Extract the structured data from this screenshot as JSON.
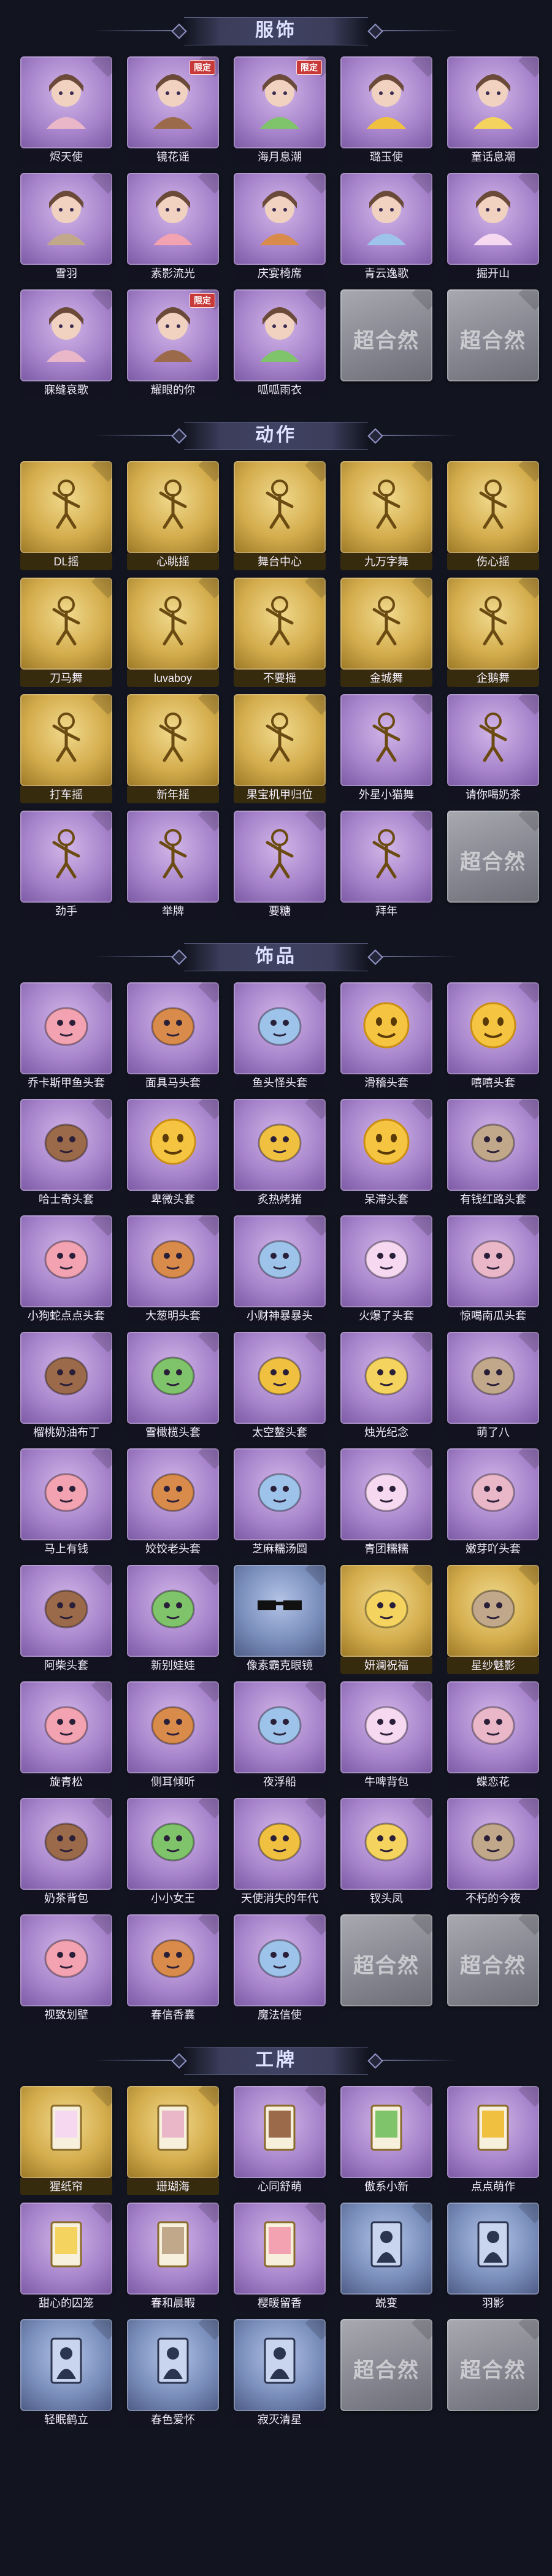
{
  "sections": [
    {
      "title": "服饰",
      "items": [
        {
          "label": "烬天使",
          "frame": "purple",
          "icon": "character-portrait-icon",
          "tag": ""
        },
        {
          "label": "镜花谣",
          "frame": "purple",
          "icon": "character-portrait-icon",
          "tag": "限定"
        },
        {
          "label": "海月息潮",
          "frame": "purple",
          "icon": "character-portrait-icon",
          "tag": "限定"
        },
        {
          "label": "璐玉使",
          "frame": "purple",
          "icon": "character-portrait-icon",
          "tag": ""
        },
        {
          "label": "童话息潮",
          "frame": "purple",
          "icon": "character-portrait-icon",
          "tag": ""
        },
        {
          "label": "雪羽",
          "frame": "purple",
          "icon": "character-portrait-icon",
          "tag": ""
        },
        {
          "label": "素影流光",
          "frame": "purple",
          "icon": "character-portrait-icon",
          "tag": ""
        },
        {
          "label": "庆宴椅席",
          "frame": "purple",
          "icon": "character-portrait-icon",
          "tag": ""
        },
        {
          "label": "青云逸歌",
          "frame": "purple",
          "icon": "character-portrait-icon",
          "tag": ""
        },
        {
          "label": "掘开山",
          "frame": "purple",
          "icon": "character-portrait-icon",
          "tag": ""
        },
        {
          "label": "寐缝哀歌",
          "frame": "purple",
          "icon": "character-portrait-icon",
          "tag": ""
        },
        {
          "label": "耀眼的你",
          "frame": "purple",
          "icon": "character-portrait-icon",
          "tag": "限定"
        },
        {
          "label": "呱呱雨衣",
          "frame": "purple",
          "icon": "character-portrait-icon",
          "tag": ""
        },
        {
          "label": "",
          "frame": "gray",
          "icon": "placeholder-icon",
          "tag": "",
          "placeholder": "超合然"
        },
        {
          "label": "",
          "frame": "gray",
          "icon": "placeholder-icon",
          "tag": "",
          "placeholder": "超合然"
        }
      ]
    },
    {
      "title": "动作",
      "items": [
        {
          "label": "DL摇",
          "frame": "gold",
          "icon": "pose-figure-icon",
          "tag": ""
        },
        {
          "label": "心眺摇",
          "frame": "gold",
          "icon": "pose-figure-icon",
          "tag": ""
        },
        {
          "label": "舞台中心",
          "frame": "gold",
          "icon": "pose-figure-icon",
          "tag": ""
        },
        {
          "label": "九万字舞",
          "frame": "gold",
          "icon": "pose-figure-icon",
          "tag": ""
        },
        {
          "label": "伤心摇",
          "frame": "gold",
          "icon": "pose-figure-icon",
          "tag": ""
        },
        {
          "label": "刀马舞",
          "frame": "gold",
          "icon": "pose-figure-icon",
          "tag": ""
        },
        {
          "label": "luvaboy",
          "frame": "gold",
          "icon": "pose-figure-icon",
          "tag": ""
        },
        {
          "label": "不要摇",
          "frame": "gold",
          "icon": "pose-figure-icon",
          "tag": ""
        },
        {
          "label": "金城舞",
          "frame": "gold",
          "icon": "pose-figure-icon",
          "tag": ""
        },
        {
          "label": "企鹅舞",
          "frame": "gold",
          "icon": "pose-figure-icon",
          "tag": ""
        },
        {
          "label": "打车摇",
          "frame": "gold",
          "icon": "pose-figure-icon",
          "tag": ""
        },
        {
          "label": "新年摇",
          "frame": "gold",
          "icon": "pose-figure-icon",
          "tag": ""
        },
        {
          "label": "果宝机甲归位",
          "frame": "gold",
          "icon": "pose-figure-icon",
          "tag": ""
        },
        {
          "label": "外星小猫舞",
          "frame": "purple",
          "icon": "pose-figure-icon",
          "tag": ""
        },
        {
          "label": "请你喝奶茶",
          "frame": "purple",
          "icon": "pose-figure-icon",
          "tag": ""
        },
        {
          "label": "劲手",
          "frame": "purple",
          "icon": "pose-figure-icon",
          "tag": ""
        },
        {
          "label": "举牌",
          "frame": "purple",
          "icon": "pose-figure-icon",
          "tag": ""
        },
        {
          "label": "要糖",
          "frame": "purple",
          "icon": "pose-figure-icon",
          "tag": ""
        },
        {
          "label": "拜年",
          "frame": "purple",
          "icon": "pose-figure-icon",
          "tag": ""
        },
        {
          "label": "",
          "frame": "gray",
          "icon": "placeholder-icon",
          "tag": "",
          "placeholder": "超合然"
        }
      ]
    },
    {
      "title": "饰品",
      "items": [
        {
          "label": "乔卡斯甲鱼头套",
          "frame": "purple",
          "icon": "accessory-icon",
          "tag": ""
        },
        {
          "label": "面具马头套",
          "frame": "purple",
          "icon": "accessory-icon",
          "tag": ""
        },
        {
          "label": "鱼头怪头套",
          "frame": "purple",
          "icon": "accessory-icon",
          "tag": ""
        },
        {
          "label": "滑稽头套",
          "frame": "purple",
          "icon": "emoji-face-icon",
          "tag": ""
        },
        {
          "label": "嘻嘻头套",
          "frame": "purple",
          "icon": "emoji-face-icon",
          "tag": ""
        },
        {
          "label": "哈士奇头套",
          "frame": "purple",
          "icon": "accessory-icon",
          "tag": ""
        },
        {
          "label": "卑微头套",
          "frame": "purple",
          "icon": "emoji-face-icon",
          "tag": ""
        },
        {
          "label": "炙热烤猪",
          "frame": "purple",
          "icon": "accessory-icon",
          "tag": ""
        },
        {
          "label": "呆滞头套",
          "frame": "purple",
          "icon": "emoji-face-icon",
          "tag": ""
        },
        {
          "label": "有钱红路头套",
          "frame": "purple",
          "icon": "accessory-icon",
          "tag": ""
        },
        {
          "label": "小狗蛇点点头套",
          "frame": "purple",
          "icon": "accessory-icon",
          "tag": ""
        },
        {
          "label": "大葱明头套",
          "frame": "purple",
          "icon": "accessory-icon",
          "tag": ""
        },
        {
          "label": "小财神暴暴头",
          "frame": "purple",
          "icon": "accessory-icon",
          "tag": ""
        },
        {
          "label": "火爆了头套",
          "frame": "purple",
          "icon": "accessory-icon",
          "tag": ""
        },
        {
          "label": "惊喝南瓜头套",
          "frame": "purple",
          "icon": "accessory-icon",
          "tag": ""
        },
        {
          "label": "榴桃奶油布丁",
          "frame": "purple",
          "icon": "accessory-icon",
          "tag": ""
        },
        {
          "label": "雪橄榄头套",
          "frame": "purple",
          "icon": "accessory-icon",
          "tag": ""
        },
        {
          "label": "太空鳌头套",
          "frame": "purple",
          "icon": "accessory-icon",
          "tag": ""
        },
        {
          "label": "烛光纪念",
          "frame": "purple",
          "icon": "accessory-icon",
          "tag": ""
        },
        {
          "label": "萌了八",
          "frame": "purple",
          "icon": "accessory-icon",
          "tag": ""
        },
        {
          "label": "马上有钱",
          "frame": "purple",
          "icon": "accessory-icon",
          "tag": ""
        },
        {
          "label": "姣饺老头套",
          "frame": "purple",
          "icon": "accessory-icon",
          "tag": ""
        },
        {
          "label": "芝麻糯汤圆",
          "frame": "purple",
          "icon": "accessory-icon",
          "tag": ""
        },
        {
          "label": "青团糯糯",
          "frame": "purple",
          "icon": "accessory-icon",
          "tag": ""
        },
        {
          "label": "嫩芽吖头套",
          "frame": "purple",
          "icon": "accessory-icon",
          "tag": ""
        },
        {
          "label": "阿柴头套",
          "frame": "purple",
          "icon": "accessory-icon",
          "tag": ""
        },
        {
          "label": "新别娃娃",
          "frame": "purple",
          "icon": "accessory-icon",
          "tag": ""
        },
        {
          "label": "像素霸克眼镜",
          "frame": "blue",
          "icon": "sunglasses-icon",
          "tag": ""
        },
        {
          "label": "妍澜祝福",
          "frame": "gold",
          "icon": "accessory-icon",
          "tag": ""
        },
        {
          "label": "星纱魅影",
          "frame": "gold",
          "icon": "accessory-icon",
          "tag": ""
        },
        {
          "label": "旋青松",
          "frame": "purple",
          "icon": "accessory-icon",
          "tag": ""
        },
        {
          "label": "侧耳倾听",
          "frame": "purple",
          "icon": "accessory-icon",
          "tag": ""
        },
        {
          "label": "夜浮船",
          "frame": "purple",
          "icon": "accessory-icon",
          "tag": ""
        },
        {
          "label": "牛啤背包",
          "frame": "purple",
          "icon": "accessory-icon",
          "tag": ""
        },
        {
          "label": "蝶恋花",
          "frame": "purple",
          "icon": "accessory-icon",
          "tag": ""
        },
        {
          "label": "奶茶背包",
          "frame": "purple",
          "icon": "accessory-icon",
          "tag": ""
        },
        {
          "label": "小小女王",
          "frame": "purple",
          "icon": "accessory-icon",
          "tag": ""
        },
        {
          "label": "天使消失的年代",
          "frame": "purple",
          "icon": "accessory-icon",
          "tag": ""
        },
        {
          "label": "钗头凤",
          "frame": "purple",
          "icon": "accessory-icon",
          "tag": ""
        },
        {
          "label": "不朽的今夜",
          "frame": "purple",
          "icon": "accessory-icon",
          "tag": ""
        },
        {
          "label": "视致划壁",
          "frame": "purple",
          "icon": "accessory-icon",
          "tag": ""
        },
        {
          "label": "春信香囊",
          "frame": "purple",
          "icon": "accessory-icon",
          "tag": ""
        },
        {
          "label": "魔法信使",
          "frame": "purple",
          "icon": "accessory-icon",
          "tag": ""
        },
        {
          "label": "",
          "frame": "gray",
          "icon": "placeholder-icon",
          "tag": "",
          "placeholder": "超合然"
        },
        {
          "label": "",
          "frame": "gray",
          "icon": "placeholder-icon",
          "tag": "",
          "placeholder": "超合然"
        }
      ]
    },
    {
      "title": "工牌",
      "items": [
        {
          "label": "猩纸帘",
          "frame": "gold",
          "icon": "badge-card-icon",
          "tag": ""
        },
        {
          "label": "珊瑚海",
          "frame": "gold",
          "icon": "badge-card-icon",
          "tag": ""
        },
        {
          "label": "心同舒萌",
          "frame": "purple",
          "icon": "badge-card-icon",
          "tag": ""
        },
        {
          "label": "傲系小新",
          "frame": "purple",
          "icon": "badge-card-icon",
          "tag": ""
        },
        {
          "label": "点点萌作",
          "frame": "purple",
          "icon": "badge-card-icon",
          "tag": ""
        },
        {
          "label": "甜心的囚笼",
          "frame": "purple",
          "icon": "badge-card-icon",
          "tag": ""
        },
        {
          "label": "春和晨暇",
          "frame": "purple",
          "icon": "badge-card-icon",
          "tag": ""
        },
        {
          "label": "樱暖留香",
          "frame": "purple",
          "icon": "badge-card-icon",
          "tag": ""
        },
        {
          "label": "蜕变",
          "frame": "blue",
          "icon": "silhouette-card-icon",
          "tag": ""
        },
        {
          "label": "羽影",
          "frame": "blue",
          "icon": "silhouette-card-icon",
          "tag": ""
        },
        {
          "label": "轻眠鹤立",
          "frame": "blue",
          "icon": "silhouette-card-icon",
          "tag": ""
        },
        {
          "label": "春色爱怀",
          "frame": "blue",
          "icon": "silhouette-card-icon",
          "tag": ""
        },
        {
          "label": "寂灭清星",
          "frame": "blue",
          "icon": "silhouette-card-icon",
          "tag": ""
        },
        {
          "label": "",
          "frame": "gray",
          "icon": "placeholder-icon",
          "tag": "",
          "placeholder": "超合然"
        },
        {
          "label": "",
          "frame": "gray",
          "icon": "placeholder-icon",
          "tag": "",
          "placeholder": "超合然"
        }
      ]
    }
  ]
}
